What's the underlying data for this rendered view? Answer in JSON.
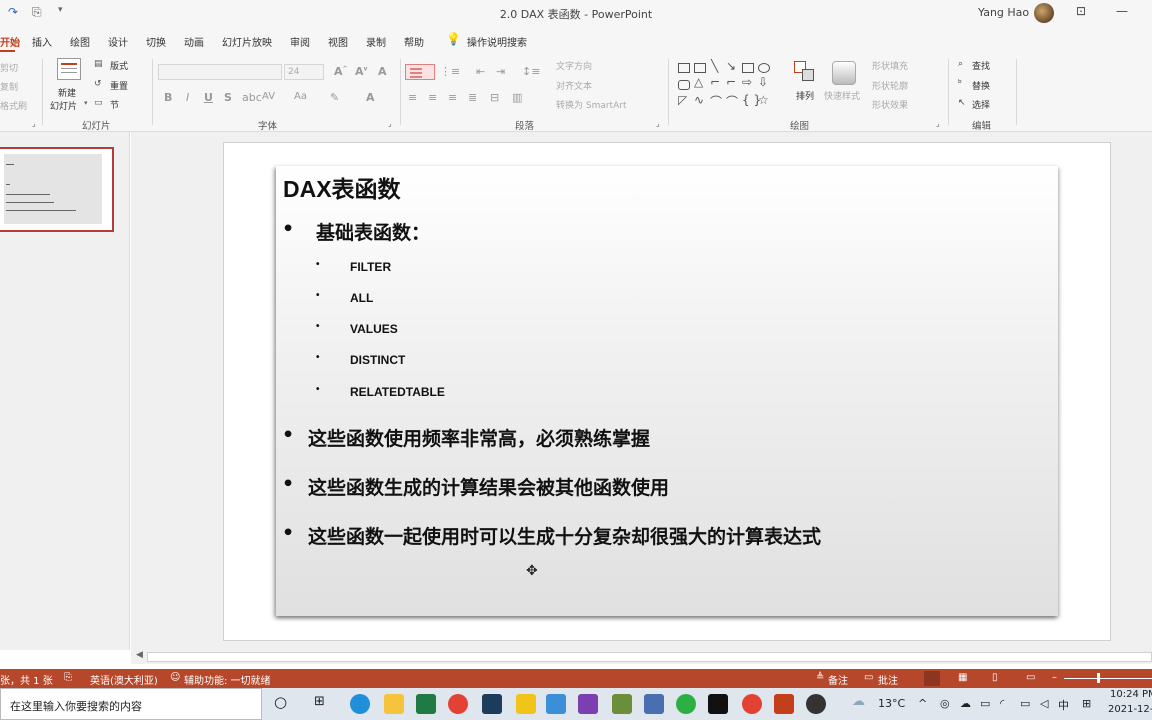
{
  "window": {
    "title": "2.0 DAX 表函数 - PowerPoint",
    "user": "Yang Hao"
  },
  "ribbon_tabs": [
    "开始",
    "插入",
    "绘图",
    "设计",
    "切换",
    "动画",
    "幻灯片放映",
    "审阅",
    "视图",
    "录制",
    "帮助",
    "操作说明搜索"
  ],
  "clipboard": {
    "cut": "剪切",
    "copy": "复制",
    "format_painter": "格式刷"
  },
  "slides_group": {
    "new_slide": "新建",
    "new_slide_2": "幻灯片",
    "layout": "版式",
    "reset": "重置",
    "section": "节",
    "label": "幻灯片"
  },
  "font_group": {
    "size": "24",
    "label": "字体"
  },
  "paragraph_group": {
    "text_direction": "文字方向",
    "align_text": "对齐文本",
    "smartart": "转换为 SmartArt",
    "label": "段落"
  },
  "drawing_group": {
    "arrange": "排列",
    "quick_styles": "快速样式",
    "shape_fill": "形状填充",
    "shape_outline": "形状轮廓",
    "shape_effects": "形状效果",
    "label": "绘图"
  },
  "editing_group": {
    "find": "查找",
    "replace": "替换",
    "select": "选择",
    "label": "编辑"
  },
  "slide": {
    "title": "DAX表函数",
    "heading": "基础表函数：",
    "functions": [
      "FILTER",
      "ALL",
      "VALUES",
      "DISTINCT",
      "RELATEDTABLE"
    ],
    "points": [
      "这些函数使用频率非常高，必须熟练掌握",
      "这些函数生成的计算结果会被其他函数使用",
      "这些函数一起使用时可以生成十分复杂却很强大的计算表达式"
    ]
  },
  "statusbar": {
    "slide_count": "张，共 1 张",
    "language": "英语(澳大利亚)",
    "accessibility": "辅助功能: 一切就绪",
    "notes": "备注",
    "comments": "批注"
  },
  "taskbar": {
    "search_placeholder": "在这里输入你要搜索的内容",
    "temperature": "13°C",
    "ime": "中",
    "time": "10:24 PM",
    "date": "2021-12-"
  }
}
